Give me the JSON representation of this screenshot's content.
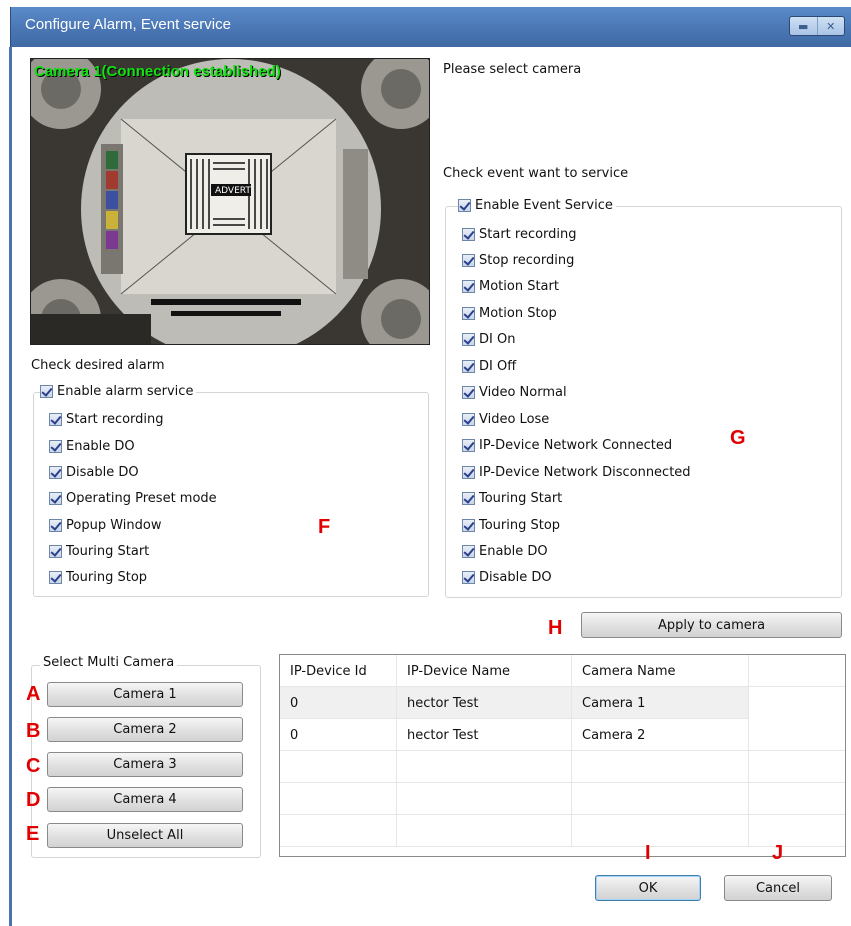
{
  "window": {
    "title": "Configure Alarm, Event service"
  },
  "preview": {
    "camera_label": "Camera 1(Connection established)"
  },
  "right": {
    "select_camera_label": "Please select camera",
    "check_event_label": "Check event want to service"
  },
  "event_service": {
    "enable_label": "Enable Event Service",
    "items": [
      "Start recording",
      "Stop recording",
      "Motion Start",
      "Motion Stop",
      "DI On",
      "DI Off",
      "Video Normal",
      "Video Lose",
      "IP-Device Network Connected",
      "IP-Device Network Disconnected",
      "Touring Start",
      "Touring Stop",
      "Enable DO",
      "Disable DO"
    ]
  },
  "alarm": {
    "check_label": "Check desired alarm",
    "enable_label": "Enable alarm service",
    "items": [
      "Start recording",
      "Enable DO",
      "Disable DO",
      "Operating Preset mode",
      "Popup Window",
      "Touring Start",
      "Touring Stop"
    ]
  },
  "apply_button": "Apply to camera",
  "multi_camera": {
    "legend": "Select Multi Camera",
    "buttons": [
      "Camera 1",
      "Camera 2",
      "Camera 3",
      "Camera 4",
      "Unselect All"
    ]
  },
  "table": {
    "columns": [
      "IP-Device Id",
      "IP-Device Name",
      "Camera Name"
    ],
    "rows": [
      [
        "0",
        "hector Test",
        "Camera 1"
      ],
      [
        "0",
        "hector Test",
        "Camera 2"
      ]
    ]
  },
  "footer": {
    "ok": "OK",
    "cancel": "Cancel"
  },
  "markers": {
    "a": "A",
    "b": "B",
    "c": "C",
    "d": "D",
    "e": "E",
    "f": "F",
    "g": "G",
    "h": "H",
    "i": "I",
    "j": "J"
  },
  "icons": {
    "minimize": "minimize-icon",
    "close": "close-icon",
    "check": "checkbox-checked-icon"
  }
}
